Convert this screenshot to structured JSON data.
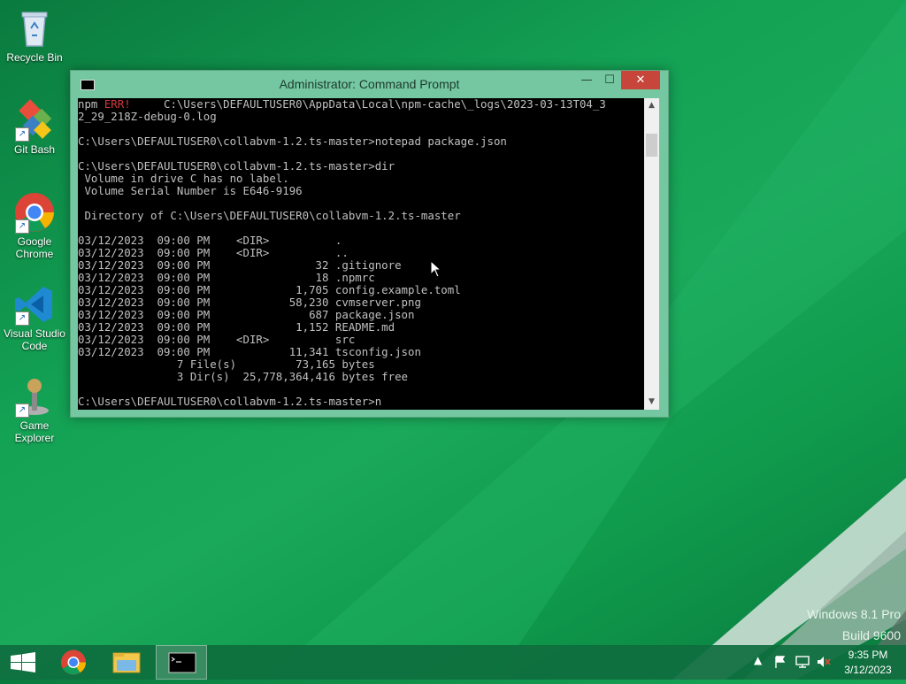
{
  "desktop": {
    "icons": [
      {
        "label": "Recycle Bin",
        "icon": "recycle-bin-icon"
      },
      {
        "label": "Git Bash",
        "icon": "git-bash-icon"
      },
      {
        "label": "Google Chrome",
        "icon": "chrome-icon"
      },
      {
        "label": "Visual Studio Code",
        "icon": "vscode-icon"
      },
      {
        "label": "Game Explorer",
        "icon": "game-explorer-icon"
      }
    ],
    "watermark": {
      "line1": "Windows 8.1 Pro",
      "line2": "Build 9600"
    }
  },
  "window": {
    "title": "Administrator: Command Prompt",
    "controls": {
      "minimize": "—",
      "maximize": "☐",
      "close": "✕"
    },
    "console": {
      "line0_prefix": "npm ",
      "line0_err": "ERR!",
      "line0_rest": "     C:\\Users\\DEFAULTUSER0\\AppData\\Local\\npm-cache\\_logs\\2023-03-13T04_3",
      "lines": [
        "2_29_218Z-debug-0.log",
        "",
        "C:\\Users\\DEFAULTUSER0\\collabvm-1.2.ts-master>notepad package.json",
        "",
        "C:\\Users\\DEFAULTUSER0\\collabvm-1.2.ts-master>dir",
        " Volume in drive C has no label.",
        " Volume Serial Number is E646-9196",
        "",
        " Directory of C:\\Users\\DEFAULTUSER0\\collabvm-1.2.ts-master",
        "",
        "03/12/2023  09:00 PM    <DIR>          .",
        "03/12/2023  09:00 PM    <DIR>          ..",
        "03/12/2023  09:00 PM                32 .gitignore",
        "03/12/2023  09:00 PM                18 .npmrc",
        "03/12/2023  09:00 PM             1,705 config.example.toml",
        "03/12/2023  09:00 PM            58,230 cvmserver.png",
        "03/12/2023  09:00 PM               687 package.json",
        "03/12/2023  09:00 PM             1,152 README.md",
        "03/12/2023  09:00 PM    <DIR>          src",
        "03/12/2023  09:00 PM            11,341 tsconfig.json",
        "               7 File(s)         73,165 bytes",
        "               3 Dir(s)  25,778,364,416 bytes free",
        "",
        "C:\\Users\\DEFAULTUSER0\\collabvm-1.2.ts-master>n"
      ]
    }
  },
  "taskbar": {
    "items": [
      {
        "icon": "windows-start-icon"
      },
      {
        "icon": "chrome-icon"
      },
      {
        "icon": "file-explorer-icon"
      },
      {
        "icon": "command-prompt-icon",
        "active": true
      }
    ],
    "tray": {
      "time": "9:35 PM",
      "date": "3/12/2023"
    }
  },
  "colors": {
    "accent": "#1aa85a",
    "error": "#d23a3a",
    "close": "#c7453a"
  }
}
